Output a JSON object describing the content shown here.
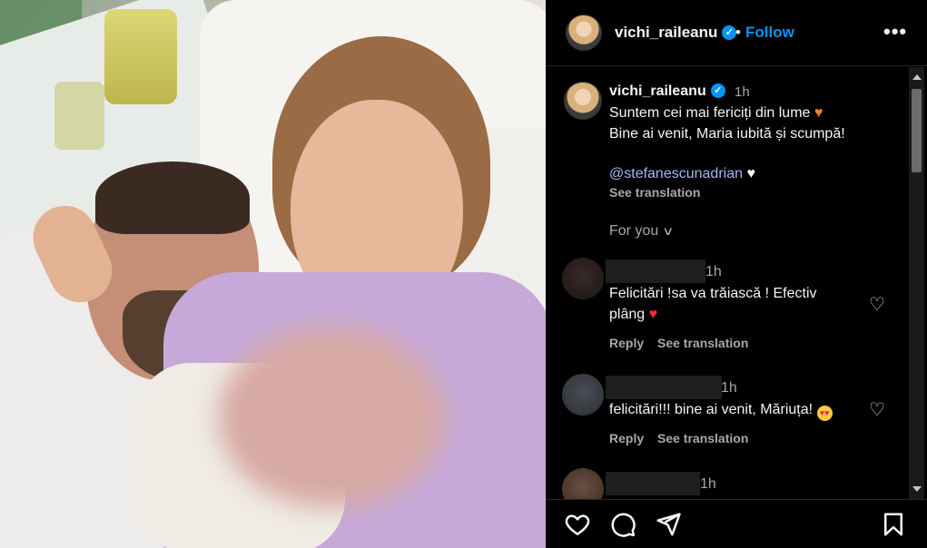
{
  "header": {
    "username": "vichi_raileanu",
    "separator": "•",
    "follow_label": "Follow",
    "more_label": "•••"
  },
  "caption": {
    "username": "vichi_raileanu",
    "time": "1h",
    "line1": "Suntem cei mai fericiți din lume",
    "line2": "Bine ai venit, Maria iubită și scumpă!",
    "mention": "@stefanescunadrian",
    "see_translation": "See translation",
    "for_you": "For you"
  },
  "comments": [
    {
      "time": "1h",
      "line1": "Felicitări !sa va trăiască ! Efectiv",
      "line2": "plâng",
      "reply": "Reply",
      "see_translation": "See translation"
    },
    {
      "time": "1h",
      "line1": "felicitări!!! bine ai venit, Măriuța!",
      "reply": "Reply",
      "see_translation": "See translation"
    },
    {
      "time": "1h"
    }
  ],
  "icons": {
    "verified": "verified-badge-icon",
    "like": "heart-icon",
    "comment": "comment-icon",
    "share": "send-icon",
    "save": "bookmark-icon"
  },
  "colors": {
    "accent": "#0095f6",
    "background": "#000000",
    "secondary_text": "#a8a8a8"
  }
}
